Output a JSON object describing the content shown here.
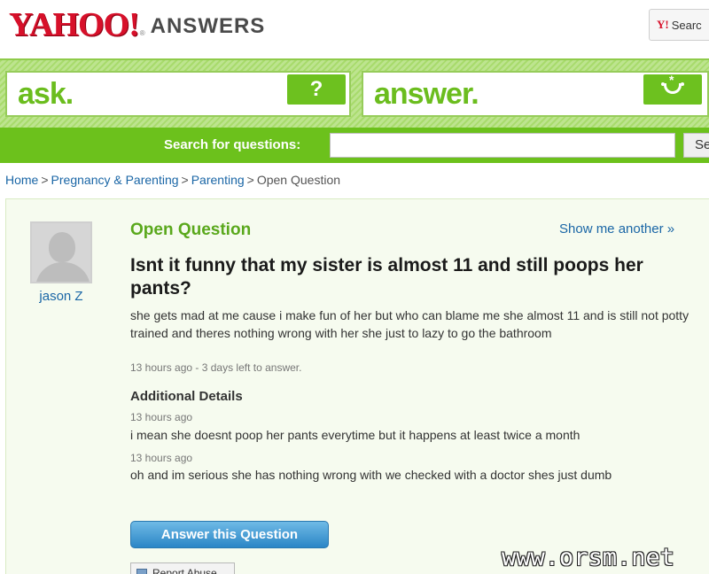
{
  "header": {
    "logo_text": "YAHOO!",
    "logo_reg": "®",
    "product": "ANSWERS",
    "top_search_mark": "Y!",
    "top_search_label": "Searc"
  },
  "nav": {
    "ask_label": "ask.",
    "ask_icon": "?",
    "answer_label": "answer."
  },
  "search": {
    "label": "Search for questions:",
    "value": "",
    "button_label": "Se"
  },
  "breadcrumb": {
    "items": [
      "Home",
      "Pregnancy & Parenting",
      "Parenting",
      "Open Question"
    ],
    "separator": ">"
  },
  "question": {
    "status": "Open Question",
    "show_another": "Show me another »",
    "asker": "jason Z",
    "title": "Isnt it funny that my sister is almost 11 and still poops her pants?",
    "body": "she gets mad at me cause i make fun of her but who can blame me she almost 11 and is still not potty trained and theres nothing wrong with her she just to lazy to go the bathroom",
    "meta": "13 hours ago - 3 days left to answer.",
    "additional_details_heading": "Additional Details",
    "details": [
      {
        "time": "13 hours ago",
        "text": "i mean she doesnt poop her pants everytime but it happens at least twice a month"
      },
      {
        "time": "13 hours ago",
        "text": "oh and im serious she has nothing wrong with we checked with a doctor shes just dumb"
      }
    ],
    "answer_button": "Answer this Question",
    "report_button": "Report Abuse"
  },
  "watermark": "www.orsm.net",
  "colors": {
    "yahoo_red": "#d7102a",
    "green": "#6cc11c",
    "link_blue": "#1a66a6",
    "button_blue": "#2b86c6"
  }
}
